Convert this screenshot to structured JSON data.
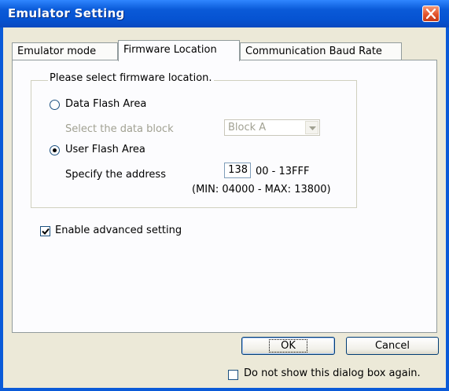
{
  "window": {
    "title": "Emulator Setting"
  },
  "tabs": [
    {
      "label": "Emulator mode"
    },
    {
      "label": "Firmware Location"
    },
    {
      "label": "Communication Baud Rate"
    }
  ],
  "firmware": {
    "group_label": "Please select firmware location.",
    "data_flash_label": "Data Flash Area",
    "select_block_label": "Select the data block",
    "block_value": "Block A",
    "user_flash_label": "User Flash Area",
    "specify_address_label": "Specify the address",
    "address_value": "138",
    "address_suffix": "00 - 13FFF",
    "range_hint": "(MIN: 04000 - MAX: 13800)",
    "selected_option": "User Flash Area"
  },
  "advanced": {
    "label": "Enable advanced setting",
    "checked": true
  },
  "buttons": {
    "ok": "OK",
    "cancel": "Cancel"
  },
  "footer": {
    "dont_show_label": "Do not show this dialog box again.",
    "checked": false
  },
  "colors": {
    "titlebar": "#0a5ad8",
    "close": "#e2532c",
    "face": "#ece9d8"
  }
}
